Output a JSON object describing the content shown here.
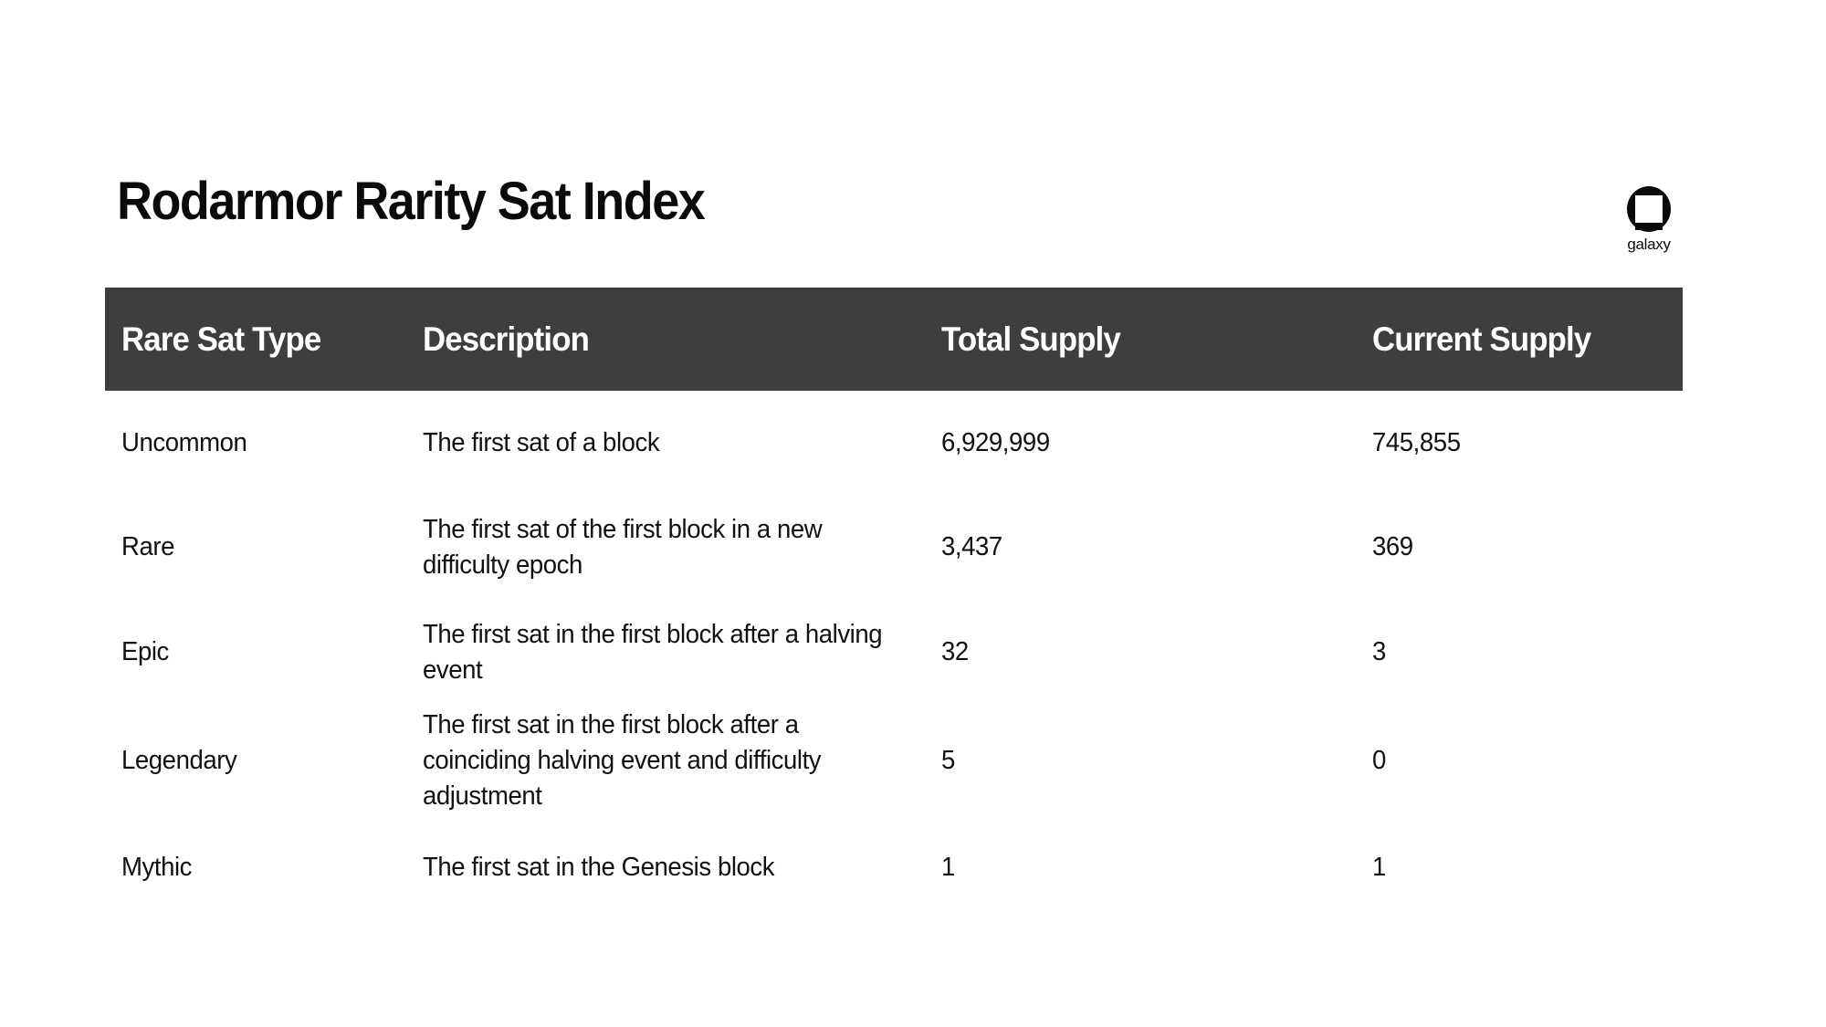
{
  "page": {
    "title": "Rodarmor Rarity Sat Index",
    "background_color": "#ffffff",
    "header_band_color": "#3e3e3e",
    "text_color": "#111111"
  },
  "brand": {
    "name": "galaxy",
    "mark": "galaxy-arch-square-logo"
  },
  "table": {
    "columns": [
      {
        "key": "type",
        "label": "Rare Sat Type"
      },
      {
        "key": "description",
        "label": "Description"
      },
      {
        "key": "total_supply",
        "label": "Total Supply"
      },
      {
        "key": "current_supply",
        "label": "Current Supply"
      }
    ],
    "rows": [
      {
        "type": "Uncommon",
        "description": "The first sat of a block",
        "total_supply": "6,929,999",
        "current_supply": "745,855"
      },
      {
        "type": "Rare",
        "description": "The first sat of the first block in a new difficulty epoch",
        "total_supply": "3,437",
        "current_supply": "369"
      },
      {
        "type": "Epic",
        "description": "The first sat in the first block after a halving event",
        "total_supply": "32",
        "current_supply": "3"
      },
      {
        "type": "Legendary",
        "description": "The first sat in the first block after a coinciding halving event and difficulty adjustment",
        "total_supply": "5",
        "current_supply": "0"
      },
      {
        "type": "Mythic",
        "description": "The first sat in the Genesis block",
        "total_supply": "1",
        "current_supply": "1"
      }
    ]
  }
}
